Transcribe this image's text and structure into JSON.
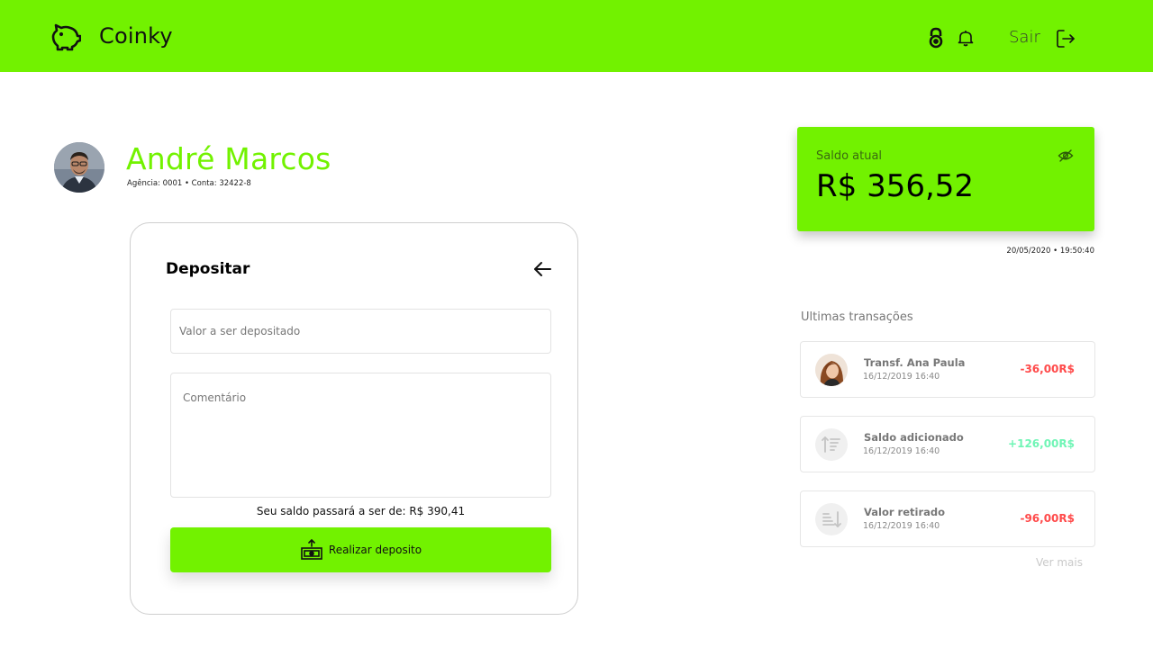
{
  "header": {
    "brand": "Coinky",
    "logout_label": "Sair",
    "accent_color": "#72f200"
  },
  "user": {
    "name": "André Marcos",
    "account_info": "Agência: 0001 • Conta: 32422-8"
  },
  "deposit": {
    "title": "Depositar",
    "amount_placeholder": "Valor a ser depositado",
    "comment_placeholder": "Comentário",
    "new_balance_text": "Seu saldo passará a ser de: R$ 390,41",
    "submit_label": "Realizar deposito"
  },
  "balance": {
    "label": "Saldo atual",
    "value": "R$ 356,52",
    "timestamp": "20/05/2020 • 19:50:40"
  },
  "transactions": {
    "heading": "Ultimas transações",
    "items": [
      {
        "title": "Transf. Ana Paula",
        "date": "16/12/2019 16:40",
        "amount": "-36,00R$",
        "kind": "negative",
        "icon": "user-avatar"
      },
      {
        "title": "Saldo adicionado",
        "date": "16/12/2019 16:40",
        "amount": "+126,00R$",
        "kind": "positive",
        "icon": "sort-ascending-icon"
      },
      {
        "title": "Valor retirado",
        "date": "16/12/2019 16:40",
        "amount": "-96,00R$",
        "kind": "negative",
        "icon": "sort-descending-icon"
      }
    ],
    "see_more": "Ver mais"
  }
}
